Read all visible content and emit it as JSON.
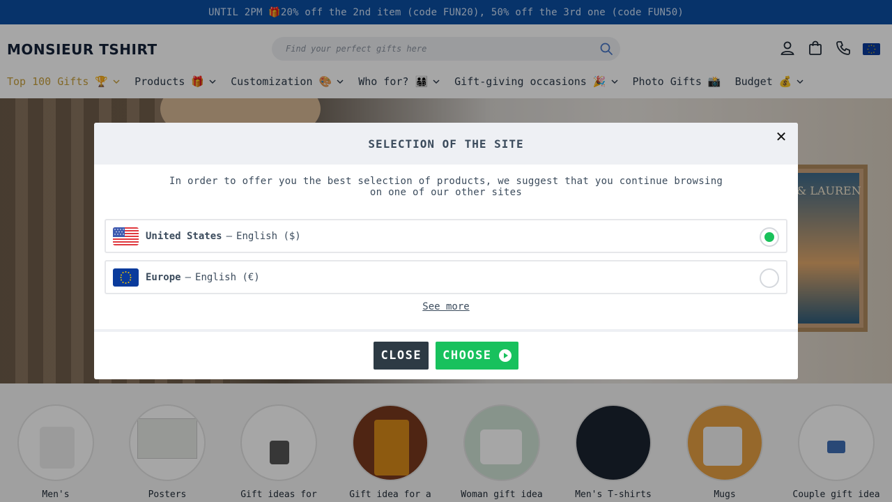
{
  "promo": {
    "text": "UNTIL 2PM 🎁20% off the 2nd item (code FUN20), 50% off the 3rd one (code FUN50)"
  },
  "header": {
    "logo": "MONSIEUR TSHIRT",
    "search_placeholder": "Find your perfect gifts here",
    "icons": [
      "account-icon",
      "cart-icon",
      "phone-icon",
      "eu-flag-icon"
    ]
  },
  "nav": {
    "items": [
      {
        "label": "Top 100 Gifts 🏆"
      },
      {
        "label": "Products 🎁"
      },
      {
        "label": "Customization 🎨"
      },
      {
        "label": "Who for? 👨‍👩‍👧‍👦"
      },
      {
        "label": "Gift-giving occasions 🎉"
      },
      {
        "label": "Photo Gifts 📸"
      },
      {
        "label": "Budget 💰"
      }
    ]
  },
  "hero": {
    "poster_title": "& LAUREN"
  },
  "modal": {
    "title": "SELECTION OF THE SITE",
    "close_symbol": "✕",
    "description_line1": "In order to offer you the best selection of products, we suggest that you continue browsing",
    "description_line2": "on one of our other sites",
    "options": [
      {
        "name": "United States",
        "lang": "English ($)",
        "selected": true
      },
      {
        "name": "Europe",
        "lang": "English (€)",
        "selected": false
      }
    ],
    "see_more": "See more",
    "close_button": "CLOSE",
    "choose_button": "CHOOSE"
  },
  "categories": [
    {
      "label": "Men's"
    },
    {
      "label": "Posters"
    },
    {
      "label": "Gift ideas for"
    },
    {
      "label": "Gift idea for a"
    },
    {
      "label": "Woman gift idea"
    },
    {
      "label": "Men's T-shirts"
    },
    {
      "label": "Mugs"
    },
    {
      "label": "Couple gift idea"
    }
  ],
  "colors": {
    "promo_bg": "#0b4fa3",
    "accent_green": "#18c15d",
    "dark_button": "#2d3a44",
    "active_nav": "#c8a03c"
  }
}
